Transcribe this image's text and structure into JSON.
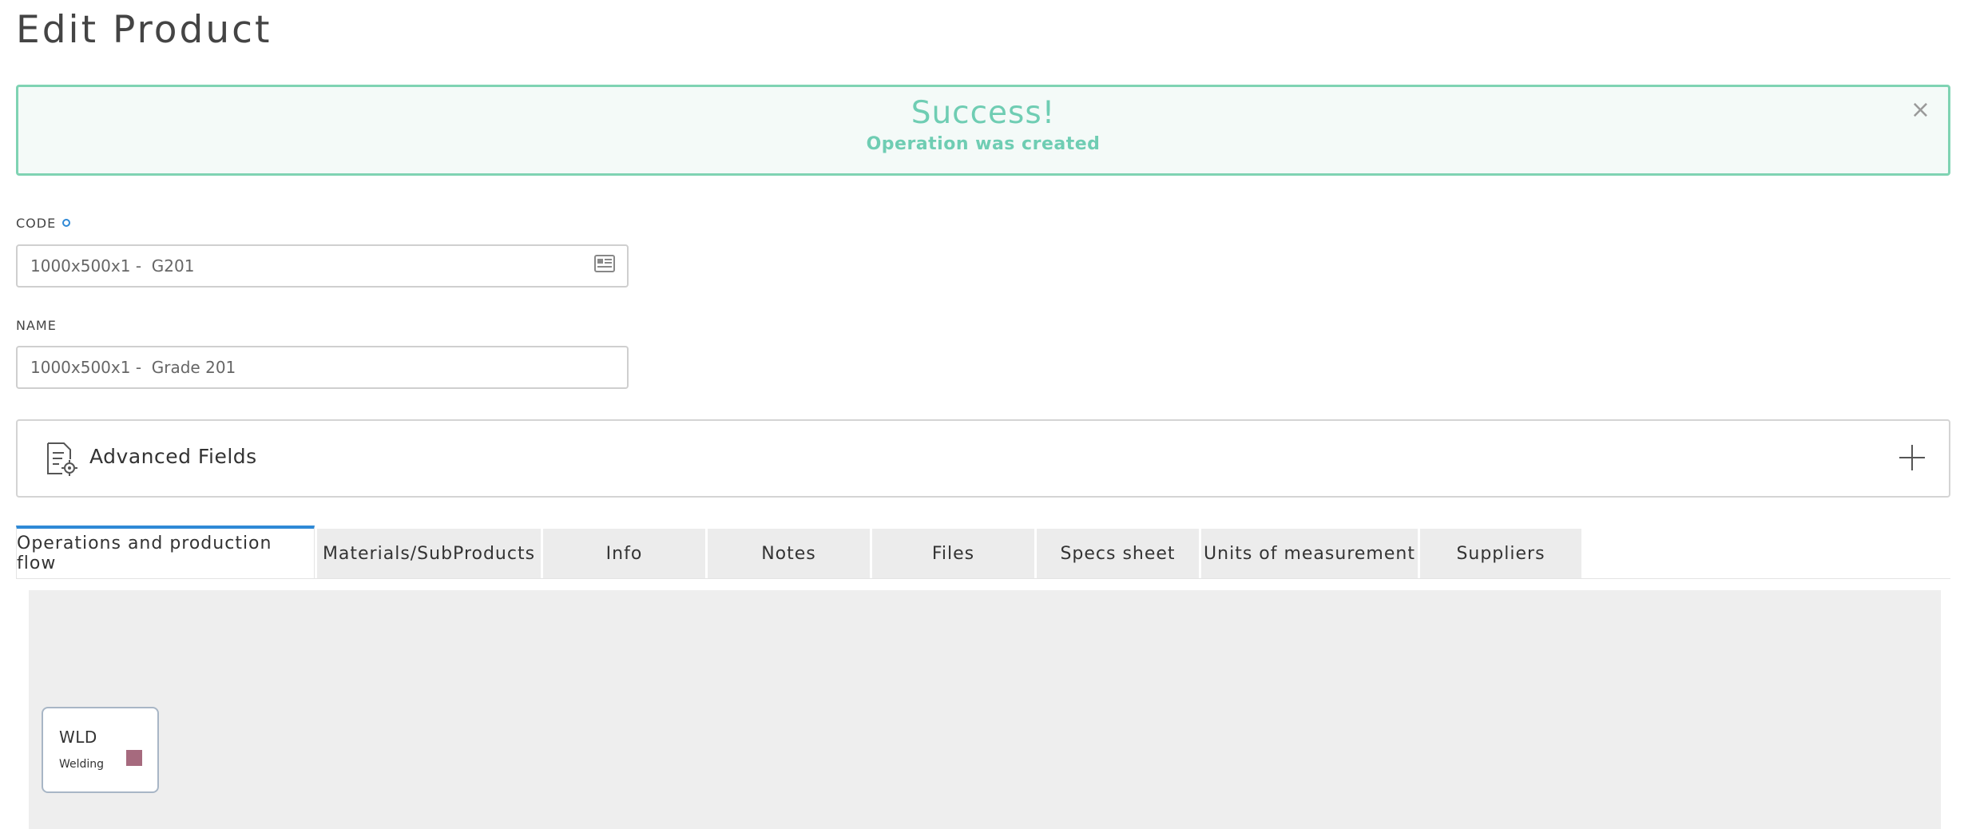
{
  "page": {
    "title": "Edit Product"
  },
  "alert": {
    "title": "Success!",
    "message": "Operation was created",
    "close_glyph": "×",
    "accent_color": "#6fcdb3",
    "close_icon": "close-icon"
  },
  "fields": {
    "code": {
      "label": "CODE",
      "value": "1000x500x1 -  G201",
      "icon": "id-card-icon"
    },
    "name": {
      "label": "NAME",
      "value": "1000x500x1 -  Grade 201"
    }
  },
  "advanced": {
    "label": "Advanced Fields",
    "icon": "document-settings-icon",
    "expand_icon": "plus-icon"
  },
  "tabs": [
    {
      "label": "Operations and production flow",
      "active": true
    },
    {
      "label": "Materials/SubProducts",
      "active": false
    },
    {
      "label": "Info",
      "active": false
    },
    {
      "label": "Notes",
      "active": false
    },
    {
      "label": "Files",
      "active": false
    },
    {
      "label": "Specs sheet",
      "active": false
    },
    {
      "label": "Units of measurement",
      "active": false
    },
    {
      "label": "Suppliers",
      "active": false
    }
  ],
  "flow": {
    "operations": [
      {
        "code": "WLD",
        "name": "Welding",
        "color": "#a66a7e"
      }
    ]
  },
  "colors": {
    "tab_active_border": "#2f89d6",
    "tab_bg": "#ececec",
    "canvas_bg": "#eeeeee"
  }
}
